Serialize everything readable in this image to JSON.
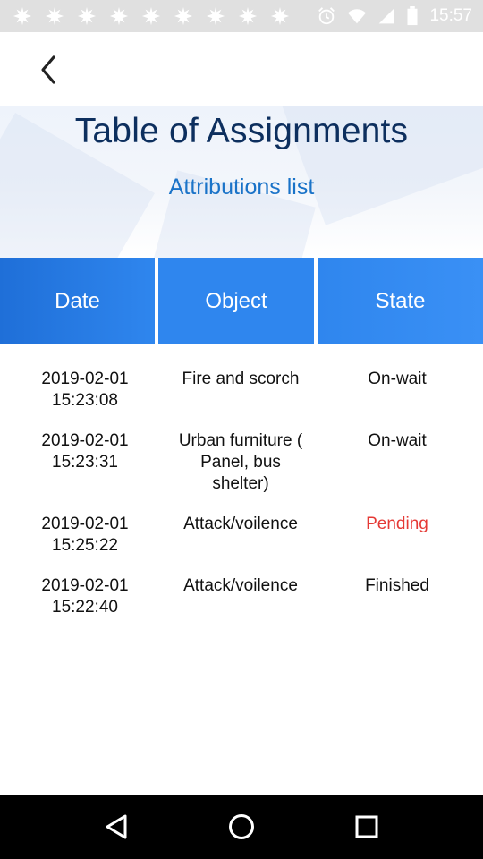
{
  "status_bar": {
    "time": "15:57",
    "notification_icons": [
      "snowflake-icon",
      "snowflake-icon",
      "snowflake-icon",
      "snowflake-icon",
      "snowflake-icon",
      "snowflake-icon",
      "snowflake-icon",
      "snowflake-icon",
      "snowflake-icon"
    ],
    "system_icons": [
      "alarm-icon",
      "wifi-icon",
      "signal-icon",
      "battery-icon"
    ]
  },
  "app_bar": {
    "back_icon": "chevron-left-icon"
  },
  "header": {
    "title": "Table of Assignments",
    "subtitle": "Attributions list"
  },
  "table": {
    "columns": [
      "Date",
      "Object",
      "State"
    ],
    "rows": [
      {
        "date": "2019-02-01",
        "time": "15:23:08",
        "object": "Fire and scorch",
        "state": "On-wait"
      },
      {
        "date": "2019-02-01",
        "time": "15:23:31",
        "object": "Urban furniture ( Panel, bus shelter)",
        "state": "On-wait"
      },
      {
        "date": "2019-02-01",
        "time": "15:25:22",
        "object": "Attack/voilence",
        "state": "Pending"
      },
      {
        "date": "2019-02-01",
        "time": "15:22:40",
        "object": "Attack/voilence",
        "state": "Finished"
      }
    ]
  },
  "colors": {
    "header_title": "#0d2f5e",
    "header_subtitle": "#1a73c8",
    "table_header": "#2f86ee",
    "pending": "#e53935"
  },
  "nav_bar": {
    "icons": [
      "back-triangle-icon",
      "home-circle-icon",
      "recents-square-icon"
    ]
  }
}
